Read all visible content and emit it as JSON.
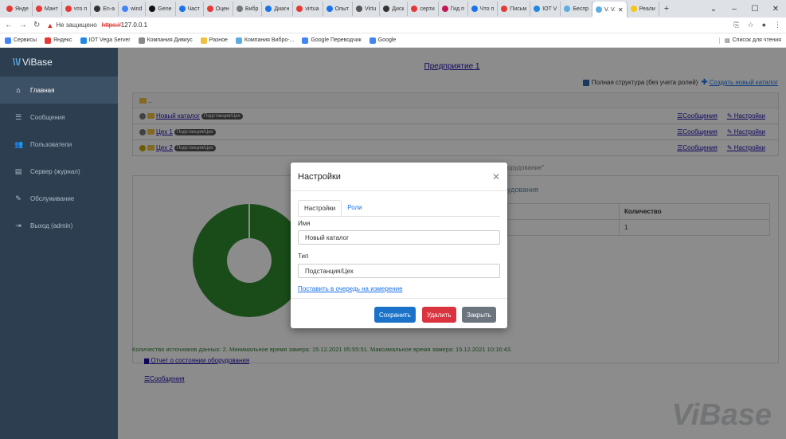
{
  "browser": {
    "tabs": [
      {
        "label": "Янде",
        "color": "#e53935"
      },
      {
        "label": "Мант",
        "color": "#e53935"
      },
      {
        "label": "что п",
        "color": "#e53935"
      },
      {
        "label": "En-a",
        "color": "#333333"
      },
      {
        "label": "wind",
        "color": "#4285f4"
      },
      {
        "label": "Gene",
        "color": "#111111"
      },
      {
        "label": "Част",
        "color": "#1a73e8"
      },
      {
        "label": "Оцен",
        "color": "#e53935"
      },
      {
        "label": "Вибр",
        "color": "#777777"
      },
      {
        "label": "Диагн",
        "color": "#1a73e8"
      },
      {
        "label": "virtua",
        "color": "#e53935"
      },
      {
        "label": "Опыт",
        "color": "#1a73e8"
      },
      {
        "label": "Virtu",
        "color": "#555555"
      },
      {
        "label": "Диск",
        "color": "#333333"
      },
      {
        "label": "серти",
        "color": "#e53935"
      },
      {
        "label": "Гид п",
        "color": "#c2185b"
      },
      {
        "label": "Что п",
        "color": "#1a73e8"
      },
      {
        "label": "Письм",
        "color": "#e53935"
      },
      {
        "label": "IOT V",
        "color": "#1e88e5"
      },
      {
        "label": "Беспр",
        "color": "#5dade2"
      }
    ],
    "active_tab": {
      "label": "V. V.",
      "color": "#5dade2"
    },
    "last_tab": {
      "label": "Реали",
      "color": "#f5c518"
    },
    "insecure_label": "Не защищено",
    "url_proto": "https://",
    "url_host": "127.0.0.1",
    "bookmarks": [
      {
        "label": "Сервисы",
        "color": "#4285f4"
      },
      {
        "label": "Яндекс",
        "color": "#e53935"
      },
      {
        "label": "IOT Vega Server",
        "color": "#1e88e5"
      },
      {
        "label": "Компания Дивиус",
        "color": "#888888"
      },
      {
        "label": "Разное",
        "color": "#f0c040"
      },
      {
        "label": "Компания Вибро-...",
        "color": "#5dade2"
      },
      {
        "label": "Google Переводчик",
        "color": "#4285f4"
      },
      {
        "label": "Google",
        "color": "#4285f4"
      }
    ],
    "reading_list": "Список для чтения"
  },
  "sidebar": {
    "brand": "ViBase",
    "items": [
      {
        "label": "Главная",
        "icon": "home-icon",
        "glyph": "⌂",
        "active": true
      },
      {
        "label": "Сообщения",
        "icon": "list-icon",
        "glyph": "☰",
        "active": false
      },
      {
        "label": "Пользователи",
        "icon": "users-icon",
        "glyph": "👥",
        "active": false
      },
      {
        "label": "Сервер (журнал)",
        "icon": "server-icon",
        "glyph": "▤",
        "active": false
      },
      {
        "label": "Обслуживание",
        "icon": "wrench-icon",
        "glyph": "✎",
        "active": false
      },
      {
        "label": "Выход (admin)",
        "icon": "logout-icon",
        "glyph": "⇥",
        "active": false
      }
    ]
  },
  "main": {
    "enterprise_title": "Предприятие 1",
    "full_structure_label": "Полная структура (без учета ролей)",
    "create_catalog_link": "Создать новый каталог",
    "tree": {
      "root_label": "..",
      "rows": [
        {
          "name": "Новый каталог",
          "badge": "Подстанция/Цех",
          "dot": "#777777"
        },
        {
          "name": "Цех 1",
          "badge": "Подстанция/Цех",
          "dot": "#777777"
        },
        {
          "name": "Цех 2",
          "badge": "Подстанция/Цех",
          "dot": "#c8a800"
        }
      ],
      "messages_link": "Сообщения",
      "settings_link": "Настройки"
    },
    "status_fragment": "Оборудование\"",
    "panel_heading": "удования",
    "table": {
      "quantity_header": "Количество",
      "quantity_value": "1"
    },
    "report_link": "Отчет о состоянии оборудования",
    "messages_link": "Сообщения",
    "footnote": "Количество источников данных: 2. Минимальное время замера: 15.12.2021 05:55:51. Максимальное время замера: 15.12.2021 10:16:43.",
    "watermark": "ViBase"
  },
  "modal": {
    "title": "Настройки",
    "tabs": [
      "Настройки",
      "Роли"
    ],
    "name_label": "Имя",
    "name_value": "Новый каталог",
    "type_label": "Тип",
    "type_value": "Подстанция/Цех",
    "queue_link": "Поставить в очередь на измерение",
    "save": "Сохранить",
    "delete": "Удалить",
    "close": "Закрыть"
  }
}
